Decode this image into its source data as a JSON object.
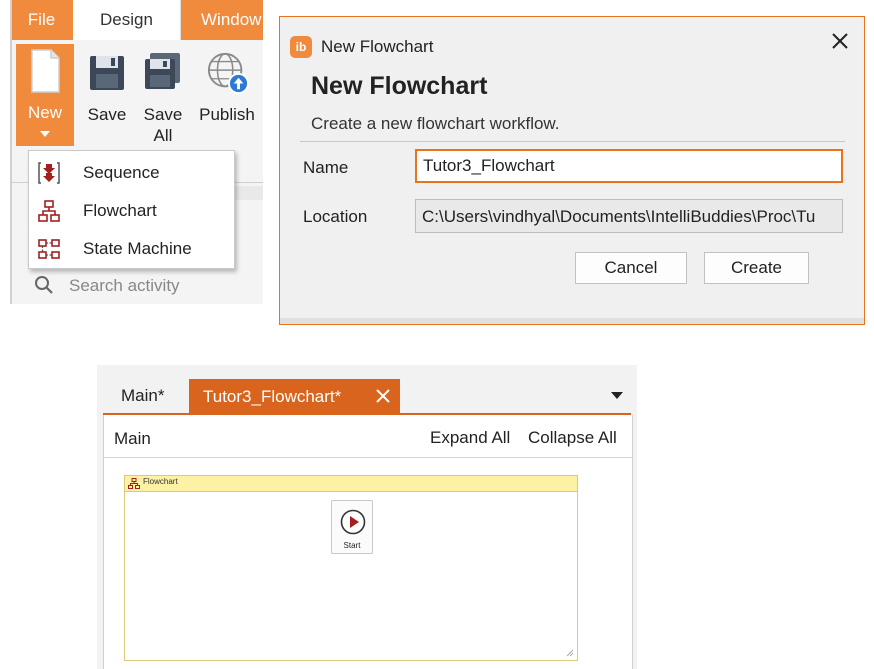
{
  "ribbon": {
    "tabs": {
      "file": "File",
      "design": "Design",
      "window": "Window"
    },
    "buttons": {
      "new": "New",
      "save": "Save",
      "save_all_1": "Save",
      "save_all_2": "All",
      "publish": "Publish"
    },
    "new_menu": {
      "sequence": "Sequence",
      "flowchart": "Flowchart",
      "state_machine": "State Machine"
    },
    "search_placeholder": "Search activity"
  },
  "dialog": {
    "window_title": "New Flowchart",
    "heading": "New Flowchart",
    "description": "Create a new flowchart workflow.",
    "name_label": "Name",
    "name_value": "Tutor3_Flowchart",
    "location_label": "Location",
    "location_value": "C:\\Users\\vindhyal\\Documents\\IntelliBuddies\\Proc\\Tu",
    "cancel": "Cancel",
    "create": "Create",
    "logo_text": "ib"
  },
  "editor": {
    "tabs": {
      "main": "Main*",
      "flowchart": "Tutor3_Flowchart*"
    },
    "breadcrumb": "Main",
    "expand_all": "Expand All",
    "collapse_all": "Collapse All",
    "activity_title": "Flowchart",
    "start_label": "Start"
  },
  "colors": {
    "accent": "#f08a3c",
    "accent_dark": "#d8641e",
    "icon_red": "#a32020",
    "activity_header": "#fdf2a4"
  }
}
